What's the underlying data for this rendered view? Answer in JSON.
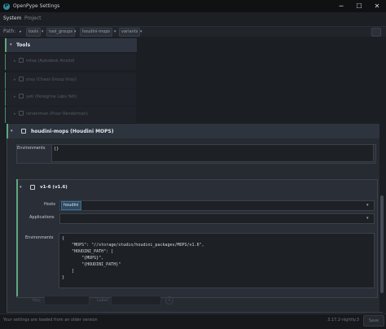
{
  "window": {
    "title": "OpenPype Settings",
    "minimize": "─",
    "maximize": "☐",
    "close": "✕"
  },
  "topbar": {
    "tabs": [
      "System",
      "Project"
    ]
  },
  "path": {
    "label": "Path:",
    "crumbs": [
      "tools",
      "tool_groups",
      "houdini-mops",
      "variants"
    ]
  },
  "tools": {
    "label": "Tools",
    "disabled_items": [
      "mtoa (Autodesk Arnold)",
      "vray (Chaos Group Vray)",
      "yeti (Peregrine Labs Yeti)",
      "renderman (Pixar Renderman)"
    ]
  },
  "mops": {
    "label": "houdini-mops (Houdini MOPS)",
    "env_label": "Environments",
    "env_value": "{}"
  },
  "variant": {
    "label": "v1-6 (v1.6)",
    "hosts_label": "Hosts",
    "hosts_value": "houdini",
    "apps_label": "Applications",
    "env_label": "Environments",
    "env_lines": [
      "{",
      "    \"MOPS\": \"//storage/studio/houdini_packages/MOPS/v1.6\",",
      "    \"HOUDINI_PATH\": [",
      "        \"{MOPS}\",",
      "        \"{HOUDINI_PATH}\"",
      "    ]",
      "}"
    ]
  },
  "new_item": {
    "key_label": "Key:",
    "label_label": "Label:",
    "add": "+"
  },
  "footer": {
    "message": "Your settings are loaded from an older version",
    "version": "3.17.2-nightly.3",
    "save": "Save"
  }
}
